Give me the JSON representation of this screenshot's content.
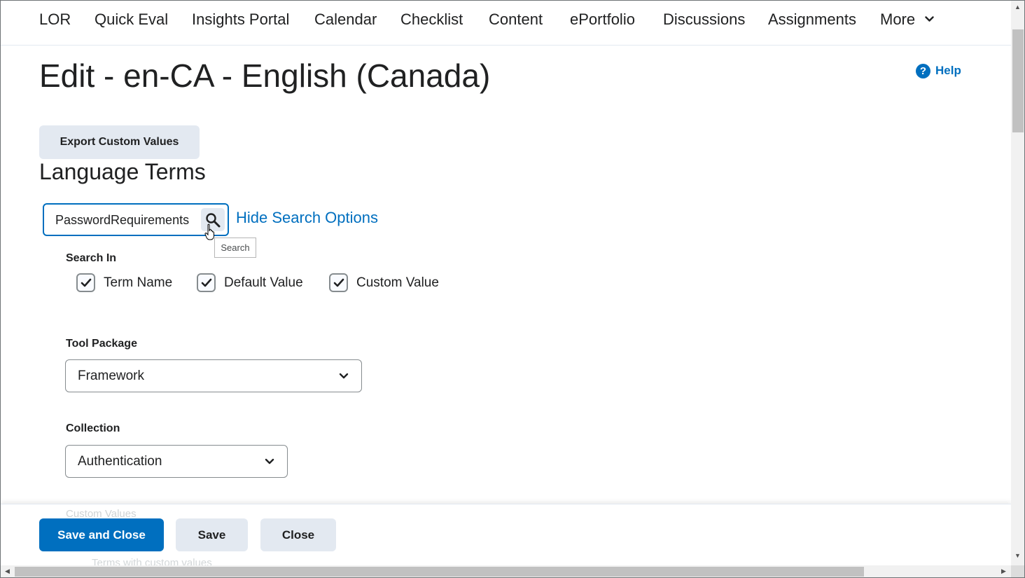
{
  "nav": {
    "items": [
      "LOR",
      "Quick Eval",
      "Insights Portal",
      "Calendar",
      "Checklist",
      "Content",
      "ePortfolio",
      "Discussions",
      "Assignments",
      "More"
    ]
  },
  "page": {
    "title": "Edit - en-CA - English (Canada)",
    "help_label": "Help",
    "export_label": "Export Custom Values",
    "section_title": "Language Terms"
  },
  "search": {
    "value": "PasswordRequirements",
    "button_tooltip": "Search",
    "toggle_label": "Hide Search Options"
  },
  "search_in": {
    "label": "Search In",
    "options": [
      {
        "label": "Term Name",
        "checked": true
      },
      {
        "label": "Default Value",
        "checked": true
      },
      {
        "label": "Custom Value",
        "checked": true
      }
    ]
  },
  "tool_package": {
    "label": "Tool Package",
    "selected": "Framework"
  },
  "collection": {
    "label": "Collection",
    "selected": "Authentication"
  },
  "custom_values": {
    "label": "Custom Values",
    "option": "Terms with custom values"
  },
  "footer": {
    "save_close": "Save and Close",
    "save": "Save",
    "close": "Close"
  },
  "colors": {
    "accent": "#006fbf",
    "button_gray": "#e3e9f1",
    "text": "#202122"
  }
}
